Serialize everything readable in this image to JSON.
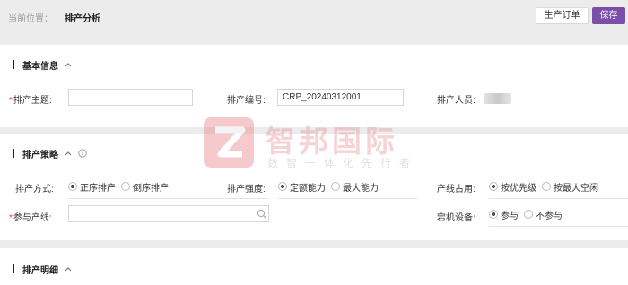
{
  "header": {
    "location_label": "当前位置：",
    "location_value": "排产分析",
    "produce_order_label": "生产订单",
    "save_label": "保存"
  },
  "basic_info": {
    "title": "基本信息",
    "subject_label": "排产主题:",
    "subject_value": "",
    "code_label": "排产编号:",
    "code_value": "CRP_20240312001",
    "person_label": "排产人员:"
  },
  "strategy": {
    "title": "排产策略",
    "method_label": "排产方式:",
    "method_options": [
      "正序排产",
      "倒序排产"
    ],
    "method_selected": 0,
    "intensity_label": "排产强度:",
    "intensity_options": [
      "定额能力",
      "最大能力"
    ],
    "intensity_selected": 0,
    "occupancy_label": "产线占用:",
    "occupancy_options": [
      "按优先级",
      "按最大空闲"
    ],
    "occupancy_selected": 0,
    "line_label": "参与产线:",
    "line_value": "",
    "downtime_label": "宕机设备:",
    "downtime_options": [
      "参与",
      "不参与"
    ],
    "downtime_selected": 0
  },
  "detail": {
    "title": "排产明细"
  },
  "watermark": {
    "name": "智邦国际",
    "slogan": "数智一体化先行者"
  },
  "colors": {
    "accent": "#7b4fa8",
    "required": "#e0433a",
    "watermark": "#e8727b"
  }
}
